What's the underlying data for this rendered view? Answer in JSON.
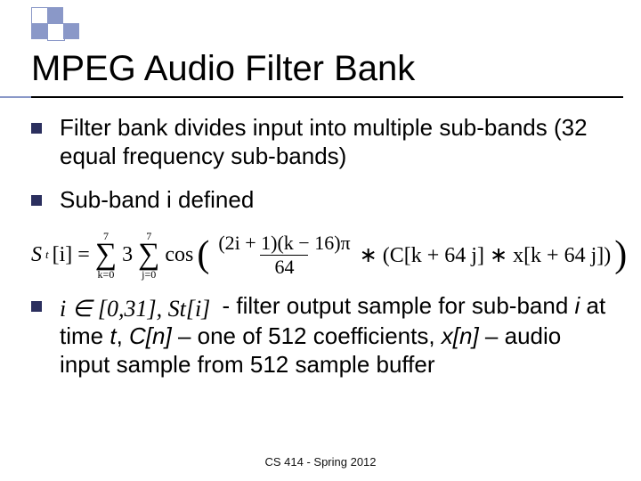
{
  "title": "MPEG Audio Filter Bank",
  "bullets": {
    "b1": "Filter bank divides input into multiple sub-bands (32 equal frequency sub-bands)",
    "b2": "Sub-band i defined",
    "b3_lead_math": "i ∈ [0,31], S",
    "b3_lead_math_tail": "[i]",
    "b3_text": " - filter output sample for sub-band ",
    "b3_text2": " at time ",
    "b3_text3": ", ",
    "b3_text4": " – one of 512 coefficients, ",
    "b3_text5": " – audio input sample from 512 sample buffer",
    "i": "i",
    "t": "t",
    "Cn": "C[n]",
    "xn": "x[n]"
  },
  "formula": {
    "lhs_S": "S",
    "lhs_t": "t",
    "lhs_idx": "[i] =",
    "sum1_top": "7",
    "sum1_bot": "k=0",
    "sum2_top": "7",
    "sum2_bot": "j=0",
    "three": "3",
    "cos": "cos",
    "num": "(2i + 1)(k − 16)π",
    "den": "64",
    "tail": " ∗ (C[k + 64 j] ∗ x[k + 64 j])"
  },
  "footer": "CS 414 - Spring 2012"
}
